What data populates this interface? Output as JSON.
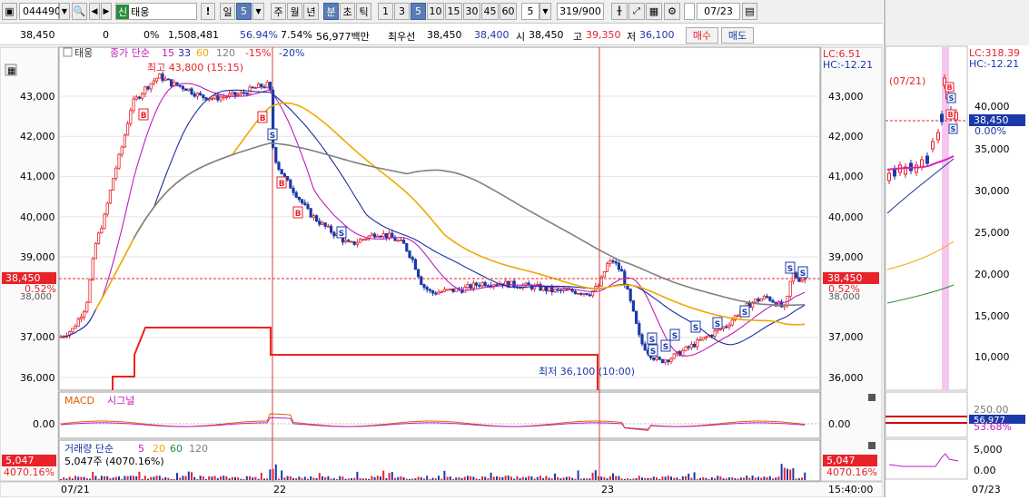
{
  "toolbar": {
    "stock_code": "044490",
    "credit_badge": "신",
    "stock_name": "태웅",
    "warn_label": "!",
    "period_day": "일",
    "period_value": "5",
    "period_buttons": [
      "주",
      "월",
      "년",
      "분",
      "초",
      "틱"
    ],
    "interval_buttons": [
      "1",
      "3",
      "5",
      "10",
      "15",
      "30",
      "45",
      "60"
    ],
    "count_value": "5",
    "page_count": "319/900",
    "date_value": "07/23"
  },
  "inforow": {
    "price": "38,450",
    "change": "0",
    "change_pct": "0%",
    "volume": "1,508,481",
    "vol_ratio": "56.94%",
    "turnover": "7.54%",
    "amount": "56,977백만",
    "priority_label": "최우선",
    "ask": "38,450",
    "bid": "38,400",
    "open_label": "시",
    "open": "38,450",
    "high_label": "고",
    "high": "39,350",
    "low_label": "저",
    "low": "36,100",
    "buy_label": "매수",
    "sell_label": "매도"
  },
  "legend": {
    "name": "태웅",
    "ma_label": "종가 단순",
    "ma_periods": [
      "15",
      "33",
      "60",
      "120"
    ],
    "pct_up": "-15%",
    "pct_down": "-20%",
    "lc": "LC:6.51",
    "hc": "HC:-12.21"
  },
  "annotations": {
    "high": "최고 43,800 (15:15)",
    "low": "최저 36,100 (10:00)"
  },
  "price_axis": {
    "labels": [
      "43,000",
      "42,000",
      "41,000",
      "40,000",
      "39,000",
      "37,000",
      "36,000"
    ],
    "current": "38,450",
    "current_pct": "0.52%",
    "under_label": "38,000"
  },
  "macd": {
    "title": "MACD",
    "signal": "시그널",
    "zero": "0.00"
  },
  "volume_pane": {
    "title": "거래량 단순",
    "periods": [
      "5",
      "20",
      "60",
      "120"
    ],
    "info": "5,047주 (4070.16%)",
    "current": "5,047",
    "current_pct": "4070.16%"
  },
  "time_axis": {
    "labels": [
      "07/21",
      "22",
      "23"
    ],
    "clock": "15:40:00"
  },
  "side": {
    "lc": "LC:318.39",
    "hc": "HC:-12.21",
    "date_mark": "(07/21)",
    "axis": [
      "40,000",
      "35,000",
      "30,000",
      "25,000",
      "20,000",
      "15,000",
      "10,000"
    ],
    "current": "38,450",
    "current_pct": "0.00%",
    "macd_top": "250.00",
    "macd_val": "56,977",
    "macd_pct": "53.68%",
    "vol_axis": [
      "5,000",
      "0.00"
    ],
    "time_label": "07/23"
  },
  "colors": {
    "up": "#e8232a",
    "down": "#1b39a8",
    "ma15": "#c01cc0",
    "ma33": "#1a2fa0",
    "ma60": "#f0a800",
    "ma120": "#808080",
    "accent": "#5b7db5"
  }
}
